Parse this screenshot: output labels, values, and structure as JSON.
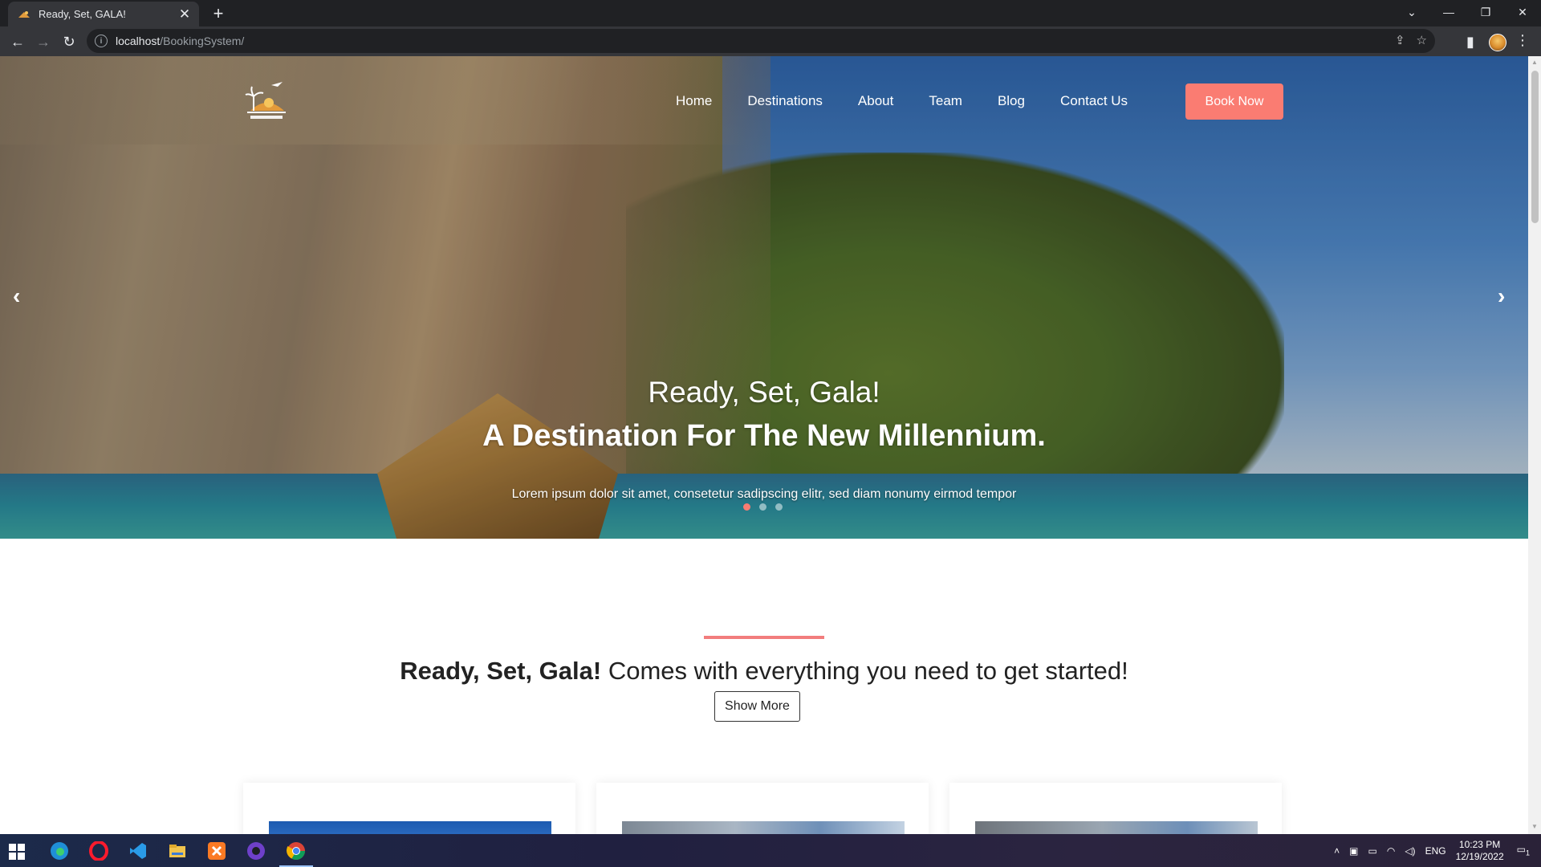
{
  "browser": {
    "tab_title": "Ready, Set, GALA!",
    "tab_close": "✕",
    "new_tab": "+",
    "url_host": "localhost",
    "url_path": "/BookingSystem/",
    "info_glyph": "i"
  },
  "site": {
    "nav": [
      "Home",
      "Destinations",
      "About",
      "Team",
      "Blog",
      "Contact Us"
    ],
    "book_now": "Book Now",
    "hero": {
      "title": "Ready, Set, Gala!",
      "subtitle": "A Destination For The New Millennium.",
      "description": "Lorem ipsum dolor sit amet, consetetur sadipscing elitr, sed diam nonumy eirmod tempor",
      "slides": 3,
      "active_slide": 1
    },
    "section": {
      "title_bold": "Ready, Set, Gala!",
      "title_rest": " Comes with everything you need to get started!",
      "button": "Show More"
    }
  },
  "taskbar": {
    "lang": "ENG",
    "time": "10:23 PM",
    "date": "12/19/2022",
    "notification_count": "1"
  },
  "colors": {
    "accent": "#fa7c72",
    "section_line": "#f27d7d",
    "chrome_dark": "#202124",
    "chrome_toolbar": "#35363a"
  }
}
